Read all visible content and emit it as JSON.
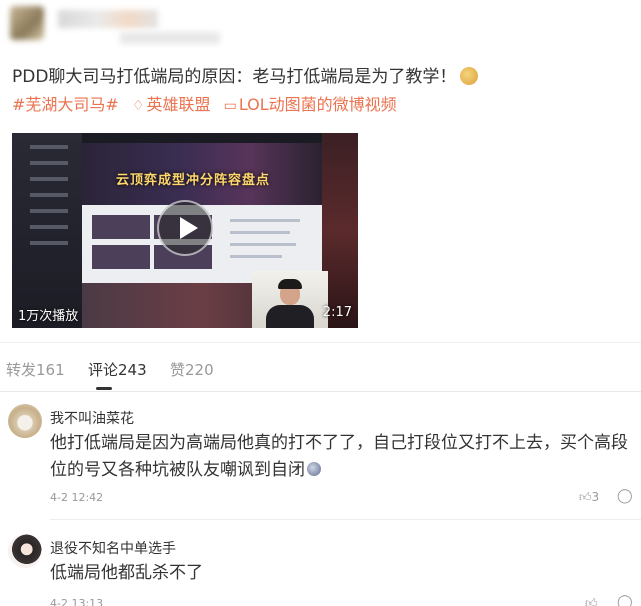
{
  "post": {
    "text": "PDD聊大司马打低端局的原因：老马打低端局是为了教学！",
    "emoji_icon": "doge-emoji-icon",
    "hashtag": "#芜湖大司马#",
    "topic_label": "英雄联盟",
    "video_source": "LOL动图菌的微博视频"
  },
  "video": {
    "banner_text": "云顶弈成型冲分阵容盘点",
    "play_count": "1万次播放",
    "duration": "2:17"
  },
  "tabs": [
    {
      "label": "转发161"
    },
    {
      "label": "评论243"
    },
    {
      "label": "赞220"
    }
  ],
  "comments": [
    {
      "user": "我不叫油菜花",
      "text": "他打低端局是因为高端局他真的打不了了，自己打段位又打不上去，买个高段位的号又各种坑被队友嘲讽到自闭",
      "date": "4-2 12:42",
      "likes": "3"
    },
    {
      "user": "退役不知名中单选手",
      "text": "低端局他都乱杀不了",
      "date": "4-2 13:13",
      "likes": ""
    }
  ],
  "colors": {
    "accent": "#eb7350",
    "text": "#333333",
    "muted": "#999999"
  }
}
